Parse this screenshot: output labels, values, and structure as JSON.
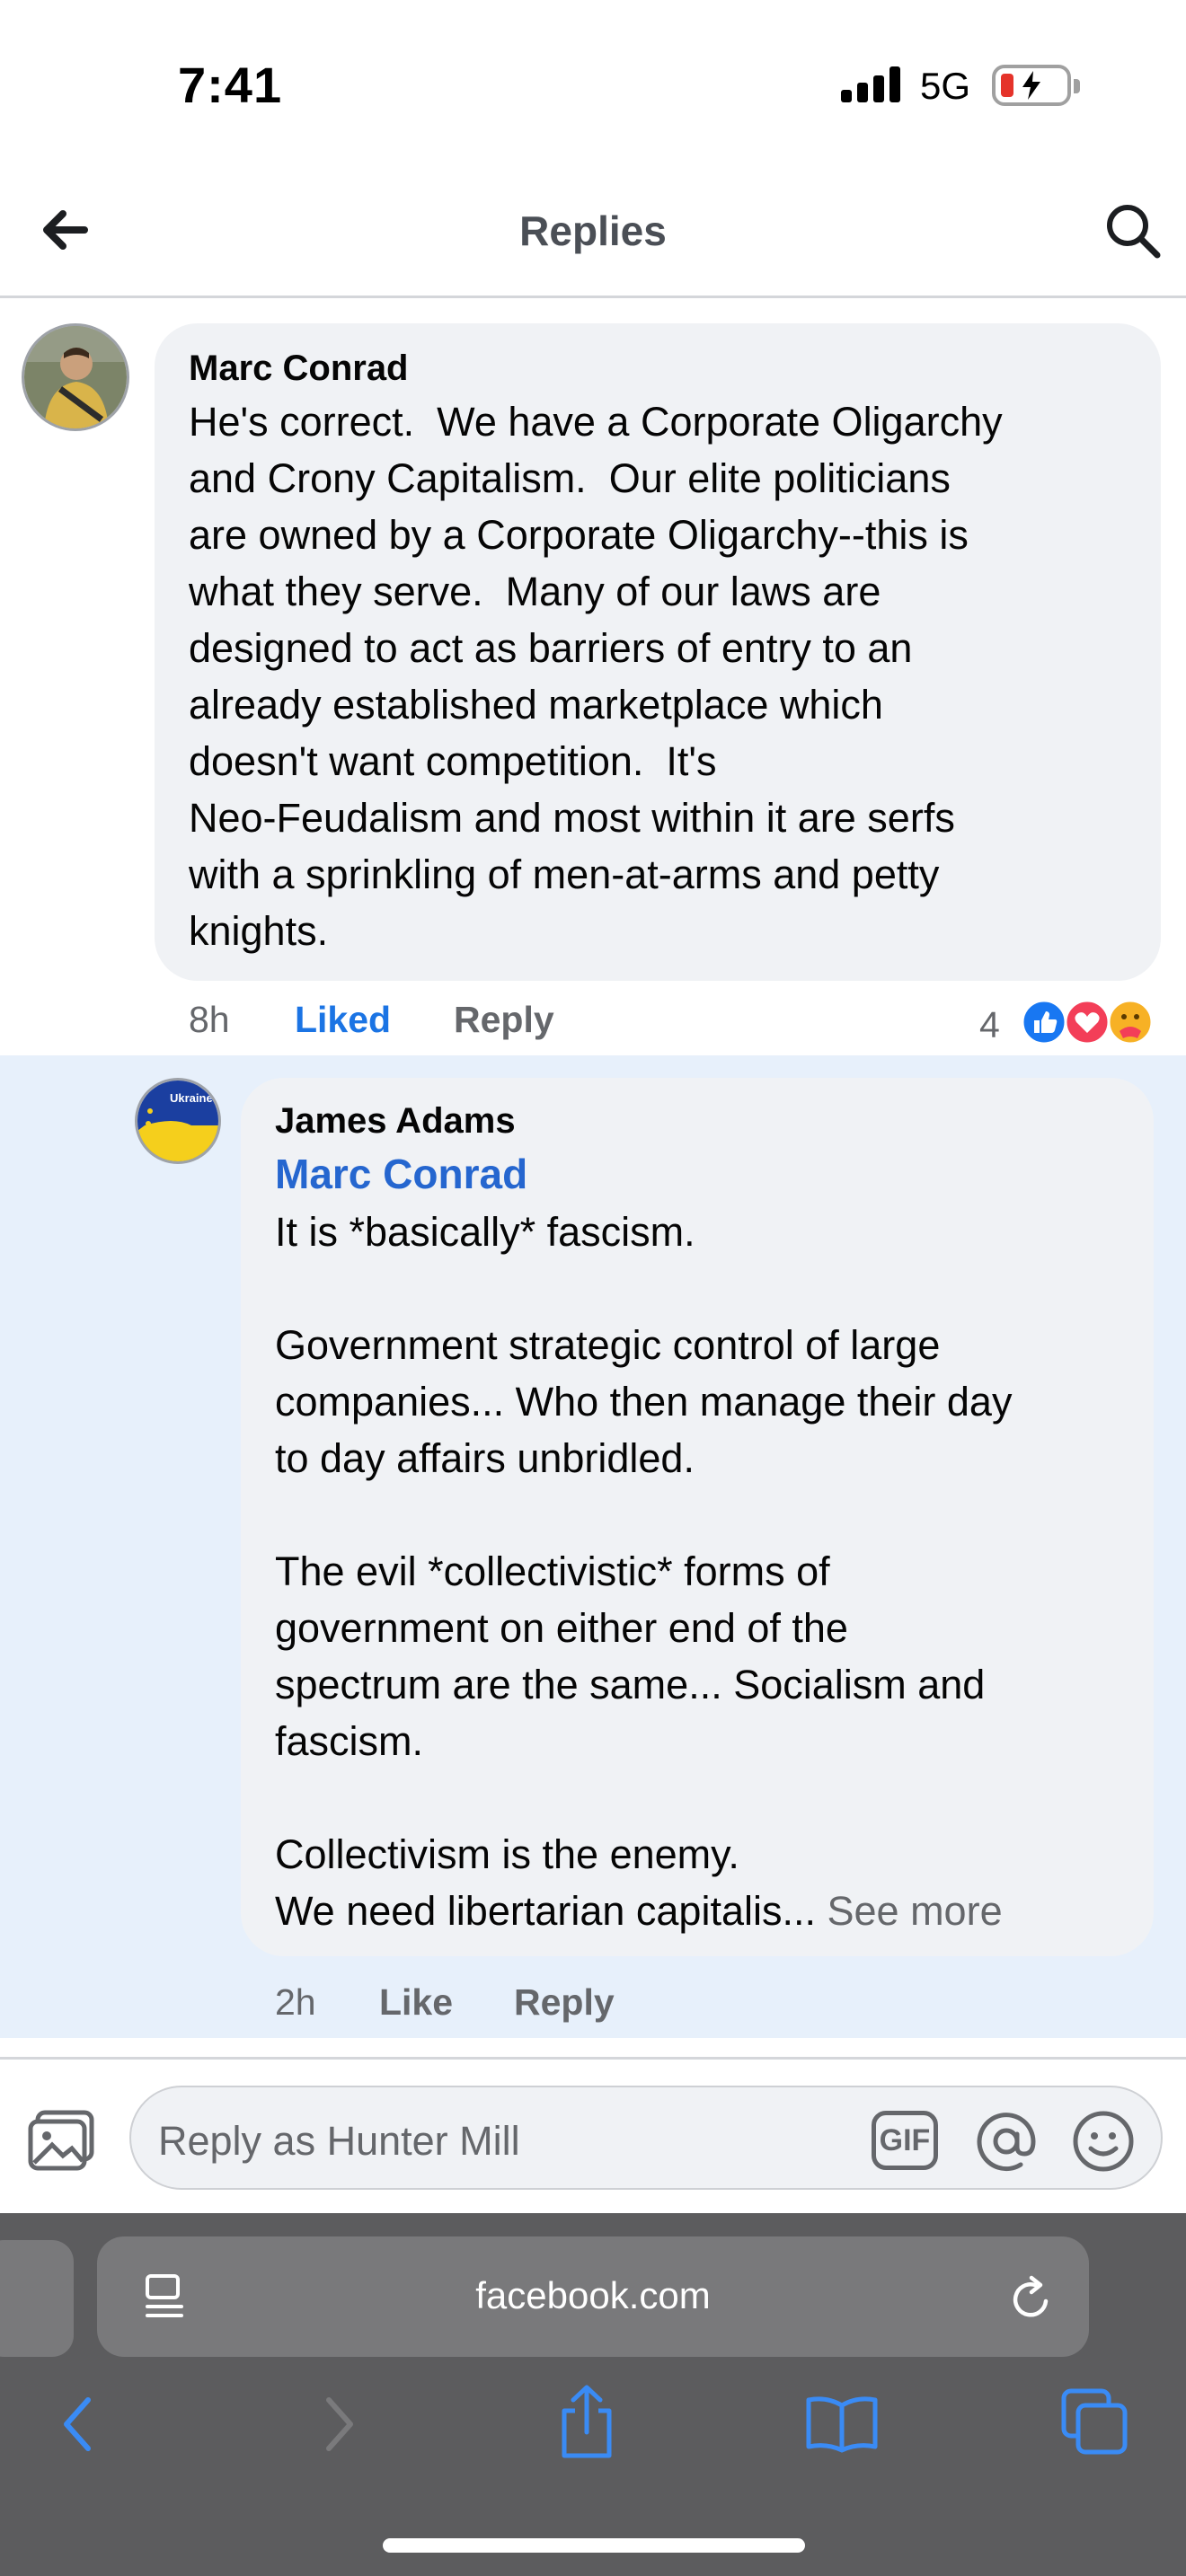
{
  "status_bar": {
    "time": "7:41",
    "network": "5G",
    "battery_color": "#e5332a"
  },
  "header": {
    "title": "Replies"
  },
  "comment": {
    "author": "Marc Conrad",
    "text": "He's correct.  We have a Corporate Oligarchy\nand Crony Capitalism.  Our elite politicians\nare owned by a Corporate Oligarchy--this is\nwhat they serve.  Many of our laws are\ndesigned to act as barriers of entry to an\nalready established marketplace which\ndoesn't want competition.  It's\nNeo-Feudalism and most within it are serfs\nwith a sprinkling of men-at-arms and petty\nknights.",
    "time": "8h",
    "like_label": "Liked",
    "reply_label": "Reply",
    "reaction_count": "4",
    "reactions": [
      "like-reaction-icon",
      "love-reaction-icon",
      "care-reaction-icon"
    ]
  },
  "reply": {
    "author": "James Adams",
    "avatar_text": "Ukraine is Europe",
    "mention": "Marc Conrad",
    "text": "It is *basically* fascism.\n\nGovernment strategic control of large\ncompanies... Who then manage their day\nto day affairs unbridled.\n\nThe evil *collectivistic* forms of\ngovernment on either end of the\nspectrum are the same... Socialism and\nfascism.\n\nCollectivism is the enemy.\nWe need libertarian capitalis...",
    "see_more": " See more",
    "time": "2h",
    "like_label": "Like",
    "reply_label": "Reply"
  },
  "composer": {
    "placeholder": "Reply as Hunter Mill",
    "gif_label": "GIF"
  },
  "browser": {
    "url": "facebook.com"
  },
  "colors": {
    "accent": "#1b74e4",
    "mention": "#2566cf",
    "highlight_bg": "#e7f0fb"
  }
}
